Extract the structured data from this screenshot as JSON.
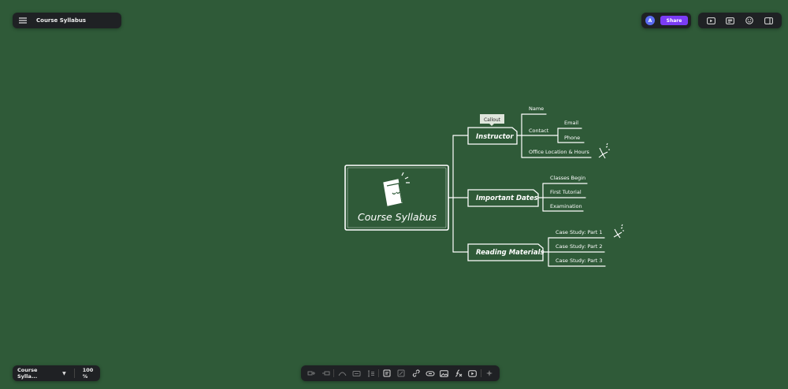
{
  "topbar": {
    "menu_icon": "hamburger-menu-icon",
    "title": "Course Syllabus"
  },
  "share": {
    "avatar_initial": "A",
    "share_label": "Share",
    "accent": "#7b3cf5"
  },
  "tools": [
    {
      "icon": "present-icon"
    },
    {
      "icon": "outline-icon"
    },
    {
      "icon": "theme-icon"
    },
    {
      "icon": "side-panel-icon"
    }
  ],
  "status": {
    "sheet_name": "Course Sylla...",
    "zoom": "100 %"
  },
  "mindmap": {
    "central": "Course Syllabus",
    "callout": "Callout",
    "topics": {
      "instructor": "Instructor",
      "dates": "Important Dates",
      "materials": "Reading Materials"
    },
    "instructor_items": {
      "name": "Name",
      "contact": "Contact",
      "email": "Email",
      "phone": "Phone",
      "office": "Office Location & Hours"
    },
    "dates_items": [
      "Classes Begin",
      "First Tutorial",
      "Examination"
    ],
    "materials_items": [
      "Case Study: Part 1",
      "Case Study: Part 2",
      "Case Study: Part 3"
    ]
  },
  "colors": {
    "canvas": "#2f5a38",
    "panel": "#1f2124",
    "line": "#ffffff"
  }
}
